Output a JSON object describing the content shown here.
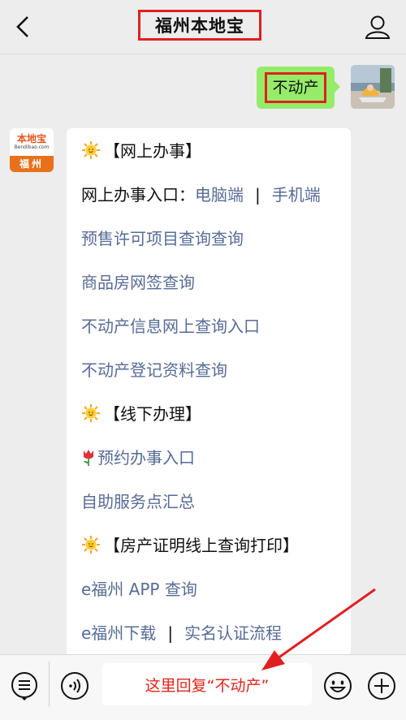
{
  "header": {
    "title": "福州本地宝"
  },
  "sent_message": {
    "text": "不动产"
  },
  "bot": {
    "logo_text": "本地宝",
    "logo_sub": "Bendibao.com",
    "logo_city": "福州"
  },
  "reply": {
    "section1": "【网上办事】",
    "entry_prefix": "网上办事入口：",
    "entry_pc": "电脑端",
    "entry_sep": "|",
    "entry_mobile": "手机端",
    "link1": "预售许可项目查询查询",
    "link2": "商品房网签查询",
    "link3": "不动产信息网上查询入口",
    "link4": "不动产登记资料查询",
    "section2": "【线下办理】",
    "link5": "预约办事入口",
    "link6": "自助服务点汇总",
    "section3": "【房产证明线上查询打印】",
    "link7": "e福州 APP 查询",
    "link8": "e福州下载",
    "link8_sep": "|",
    "link9": "实名认证流程"
  },
  "input": {
    "hint": "这里回复“不动产”"
  },
  "icons": [
    "back-icon",
    "profile-icon",
    "menu-icon",
    "voice-icon",
    "emoji-icon",
    "plus-icon",
    "sun-icon",
    "tulip-icon"
  ],
  "colors": {
    "link": "#576b95",
    "sent_bubble": "#95ec69",
    "highlight": "#e02020",
    "hint": "#e0241b"
  }
}
